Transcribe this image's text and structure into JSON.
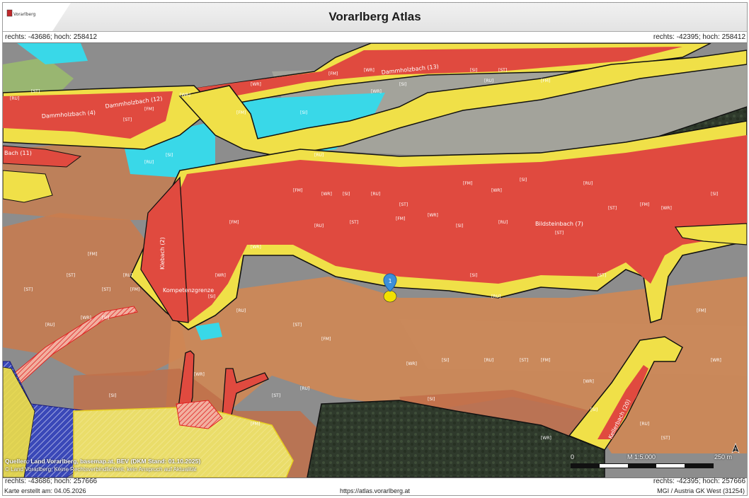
{
  "header": {
    "title": "Vorarlberg Atlas",
    "logo_text": "Vorarlberg"
  },
  "coords": {
    "top_left": "rechts: -43686; hoch: 258412",
    "top_right": "rechts: -42395; hoch: 258412",
    "bottom_left": "rechts: -43686; hoch: 257666",
    "bottom_right": "rechts: -42395; hoch: 257666"
  },
  "map": {
    "marker_label": "1",
    "stream_labels": [
      "Dammholzbach (13)",
      "Dammholzbach (4)",
      "Dammholzbach (12)",
      "Bildsteinbach (7)",
      "Klebach (2)",
      "Kompetenzgrenze",
      "Kellerbach (20)",
      "Bach (11)"
    ],
    "zone_codes": [
      "[FM]",
      "[WR]",
      "[SI]",
      "[RU]",
      "[ST]"
    ],
    "colors": {
      "red_zone": "#e04a3f",
      "yellow_zone": "#f0e048",
      "orange_zone": "#d9834d",
      "cyan_zone": "#39d8e8",
      "hatch_blue": "#2c3aa8",
      "hatch_red": "#e02020"
    }
  },
  "sources": {
    "line1": "Quellen: Land Vorarlberg, basemap.at, BEV (DKM Stand: 01.10.2025)",
    "line2": "© Land Vorarlberg; Keine Rechtsverbindlichkeit, kein Anspruch auf Aktualität"
  },
  "scale": {
    "zero": "0",
    "ratio": "M 1:5.000",
    "distance": "250 m"
  },
  "north_icon": "north-arrow-icon",
  "footer": {
    "created": "Karte erstellt am: 04.05.2026",
    "url": "https://atlas.vorarlberg.at",
    "crs": "MGI / Austria GK West (31254)"
  }
}
